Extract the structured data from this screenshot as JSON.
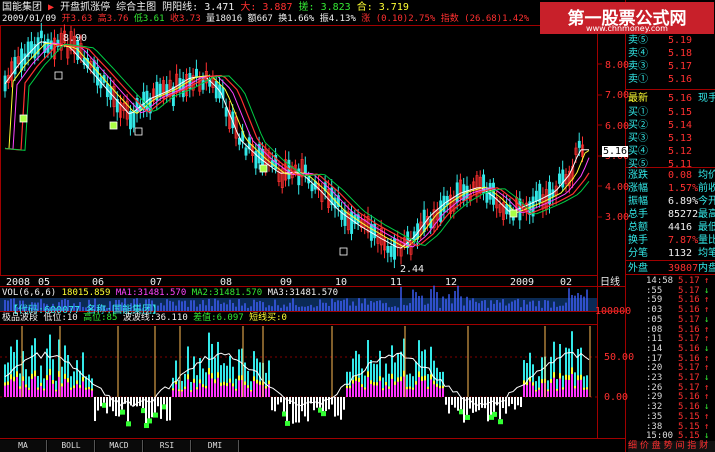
{
  "header": {
    "stock_name": "国能集团",
    "toolbar": [
      "开盘抓涨停",
      "综合主图",
      "阴阳线: 3.471",
      "大: 3.887",
      "搓: 3.823",
      "合: 3.719"
    ],
    "date": "2009/01/09",
    "open": "开3.63",
    "high": "高3.76",
    "low": "低3.61",
    "close": "收3.73",
    "volume": "量18016",
    "amount": "额667",
    "change": "换1.66%",
    "amplitude": "振4.13%",
    "rise": "涨 (0.10)2.75%",
    "index": "指数 (26.68)1.42%"
  },
  "main_chart": {
    "y_ticks": [
      "8.00",
      "7.00",
      "6.00",
      "5.00",
      "4.00",
      "3.00"
    ],
    "high_label": "8.90",
    "low_label": "2.44",
    "current_price": "5.16",
    "x_ticks": [
      "2008",
      "05",
      "06",
      "07",
      "08",
      "09",
      "10",
      "11",
      "12",
      "2009",
      "02"
    ],
    "period": "日线"
  },
  "volume_panel": {
    "name": "VOL(6,6,6)",
    "vol": "18015.859",
    "ma1": "MA1:31481.570",
    "ma2": "MA2:31481.570",
    "ma3": "MA3:31481.570",
    "info": "【代码:600077 名称:国能集团】",
    "y_tick": "100000"
  },
  "indicator_panel": {
    "title": "极品波段",
    "low": "低位:10",
    "high": "高位:85",
    "band": "波波线:36.110",
    "diff": "差值:6.097",
    "short": "短线买:0",
    "y_ticks": [
      "50.00",
      "0.00"
    ]
  },
  "tabs": [
    "MA",
    "BOLL",
    "MACD",
    "RSI",
    "DMI"
  ],
  "order_book": {
    "asks": [
      {
        "label": "卖⑤",
        "price": "5.19"
      },
      {
        "label": "卖④",
        "price": "5.18"
      },
      {
        "label": "卖③",
        "price": "5.17"
      },
      {
        "label": "卖①",
        "price": "5.16"
      }
    ],
    "latest": {
      "label": "最新",
      "price": "5.16",
      "extra": "现手"
    },
    "bids": [
      {
        "label": "买①",
        "price": "5.15"
      },
      {
        "label": "买②",
        "price": "5.14"
      },
      {
        "label": "买③",
        "price": "5.13"
      },
      {
        "label": "买④",
        "price": "5.12"
      },
      {
        "label": "买⑤",
        "price": "5.11"
      }
    ],
    "stats": [
      {
        "label": "涨跌",
        "value": "0.08",
        "extra": "均价"
      },
      {
        "label": "涨幅",
        "value": "1.57%",
        "extra": "前收"
      },
      {
        "label": "振幅",
        "value": "6.89%",
        "extra": "今开"
      },
      {
        "label": "总手",
        "value": "85272",
        "extra": "最高"
      },
      {
        "label": "总额",
        "value": "4416",
        "extra": "最低"
      },
      {
        "label": "换手",
        "value": "7.87%",
        "extra": "量比"
      },
      {
        "label": "分笔",
        "value": "1132",
        "extra": "均笔"
      }
    ],
    "outer": {
      "label": "外盘",
      "value": "39807",
      "extra": "内盘"
    }
  },
  "ticks": [
    {
      "time": "14:58",
      "price": "5.17"
    },
    {
      "time": ":55",
      "price": "5.17"
    },
    {
      "time": ":59",
      "price": "5.16"
    },
    {
      "time": ":03",
      "price": "5.16"
    },
    {
      "time": ":05",
      "price": "5.17"
    },
    {
      "time": ":08",
      "price": "5.16"
    },
    {
      "time": ":11",
      "price": "5.17"
    },
    {
      "time": ":14",
      "price": "5.16"
    },
    {
      "time": ":17",
      "price": "5.16"
    },
    {
      "time": ":20",
      "price": "5.17"
    },
    {
      "time": ":23",
      "price": "5.17"
    },
    {
      "time": ":26",
      "price": "5.17"
    },
    {
      "time": ":29",
      "price": "5.16"
    },
    {
      "time": ":32",
      "price": "5.16"
    },
    {
      "time": ":35",
      "price": "5.15"
    },
    {
      "time": ":38",
      "price": "5.15"
    },
    {
      "time": "15:00",
      "price": "5.15"
    }
  ],
  "footer_tabs": "细 价 盘 势 间 指 财",
  "watermark": {
    "name": "第一股票公式网",
    "url": "www.chnmoney.com"
  },
  "colors": {
    "up": "#ff3030",
    "down": "#33e8e8",
    "bg": "#000000",
    "frame": "#a00000"
  }
}
